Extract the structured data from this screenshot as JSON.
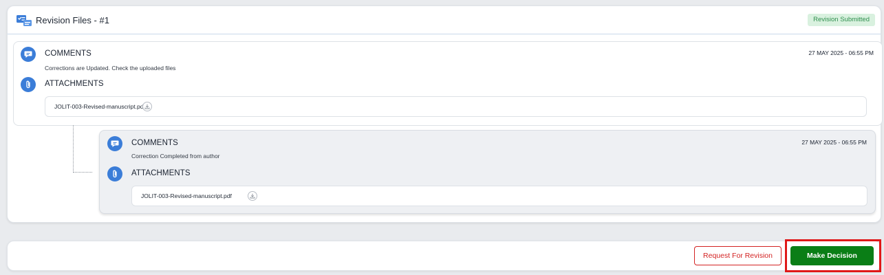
{
  "header": {
    "title": "Revision Files - #1",
    "icon": "task-list-icon",
    "status_badge": "Revision Submitted"
  },
  "entries": [
    {
      "comments_label": "COMMENTS",
      "comment_text": "Corrections are  Updated. Check the uploaded files",
      "timestamp": "27 MAY 2025 - 06:55 PM",
      "attachments_label": "ATTACHMENTS",
      "file_name": "JOLIT-003-Revised-manuscript.pdf"
    },
    {
      "comments_label": "COMMENTS",
      "comment_text": "Correction Completed from author",
      "timestamp": "27 MAY 2025 - 06:55 PM",
      "attachments_label": "ATTACHMENTS",
      "file_name": "JOLIT-003-Revised-manuscript.pdf"
    }
  ],
  "actions": {
    "request_revision": "Request For Revision",
    "make_decision": "Make Decision"
  },
  "colors": {
    "accent_blue": "#3b7dd8",
    "badge_bg": "#d9f1df",
    "badge_text": "#2f8f4e",
    "danger": "#d32222",
    "success": "#0a7e16",
    "highlight": "#e01818"
  }
}
